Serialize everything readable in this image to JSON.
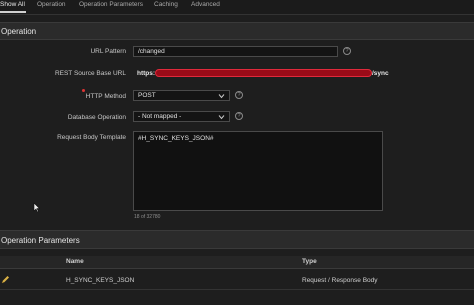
{
  "tabs": [
    "Show All",
    "Operation",
    "Operation Parameters",
    "Caching",
    "Advanced"
  ],
  "operation": {
    "section_title": "Operation",
    "url_pattern": {
      "label": "URL Pattern",
      "value": "/changed"
    },
    "rest_source_base_url": {
      "label": "REST Source Base URL",
      "prefix": "https:",
      "suffix": "/sync"
    },
    "http_method": {
      "label": "HTTP Method",
      "value": "POST"
    },
    "database_operation": {
      "label": "Database Operation",
      "value": "- Not mapped -"
    },
    "request_body_template": {
      "label": "Request Body Template",
      "value": "#H_SYNC_KEYS_JSON#",
      "counter": "18 of 32780"
    }
  },
  "operation_parameters": {
    "section_title": "Operation Parameters",
    "columns": [
      "Name",
      "Type"
    ],
    "rows": [
      {
        "name": "H_SYNC_KEYS_JSON",
        "type": "Request / Response Body"
      }
    ]
  },
  "colors": {
    "background": "#1e1e1e",
    "section_bar": "#2b2b2b",
    "redaction": "#9a0b18",
    "required": "#dd3333"
  },
  "icons": [
    "help-icon",
    "chevron-down-icon",
    "edit-pencil-icon",
    "mouse-cursor-icon"
  ]
}
